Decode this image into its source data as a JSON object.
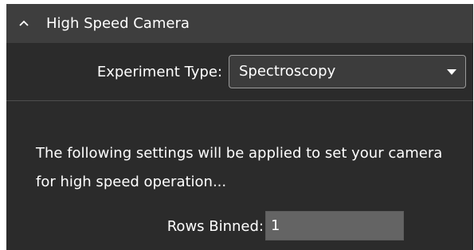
{
  "section": {
    "title": "High Speed Camera",
    "collapse_icon": "chevron-up-icon"
  },
  "experiment_type": {
    "label": "Experiment Type:",
    "selected": "Spectroscopy",
    "arrow_icon": "caret-down-icon"
  },
  "info_text": "The following settings will be applied to set your camera for high speed operation...",
  "rows_binned": {
    "label": "Rows Binned:",
    "value": "1"
  },
  "colors": {
    "panel_bg": "#2b2b2b",
    "header_bg": "#3e3e3e",
    "input_bg": "#646464",
    "text": "#ffffff"
  }
}
